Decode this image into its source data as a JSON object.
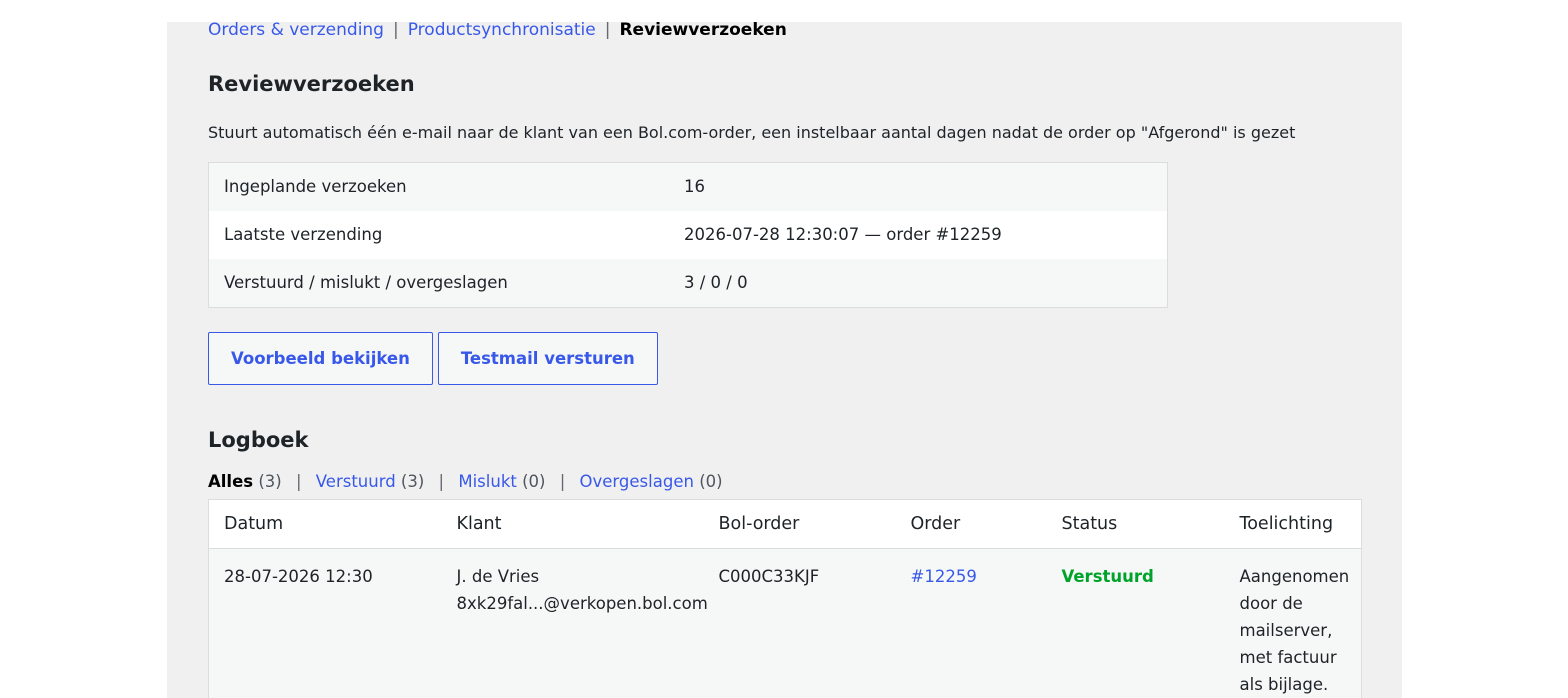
{
  "subnav": {
    "items": [
      "Orders & verzending",
      "Productsynchronisatie"
    ],
    "current": "Reviewverzoeken",
    "separator": "|"
  },
  "page": {
    "title": "Reviewverzoeken",
    "description": "Stuurt automatisch één e-mail naar de klant van een Bol.com-order, een instelbaar aantal dagen nadat de order op \"Afgerond\" is gezet"
  },
  "stats": [
    {
      "label": "Ingeplande verzoeken",
      "value": "16"
    },
    {
      "label": "Laatste verzending",
      "value": "2026-07-28 12:30:07 — order #12259"
    },
    {
      "label": "Verstuurd / mislukt / overgeslagen",
      "value": "3 / 0 / 0"
    }
  ],
  "buttons": {
    "preview": "Voorbeeld bekijken",
    "testmail": "Testmail versturen"
  },
  "log": {
    "title": "Logboek",
    "filters": [
      {
        "label": "Alles",
        "count": "(3)"
      },
      {
        "label": "Verstuurd",
        "count": "(3)"
      },
      {
        "label": "Mislukt",
        "count": "(0)"
      },
      {
        "label": "Overgeslagen",
        "count": "(0)"
      }
    ],
    "columns": [
      "Datum",
      "Klant",
      "Bol-order",
      "Order",
      "Status",
      "Toelichting"
    ],
    "rows": [
      {
        "date": "28-07-2026 12:30",
        "customer_name": "J. de Vries",
        "customer_email": "8xk29fal...@verkopen.bol.com",
        "bol_order": "C000C33KJF",
        "order": "#12259",
        "status": "Verstuurd",
        "note_lines": [
          "Aangenomen",
          "door de",
          "mailserver,",
          "met factuur",
          "als bijlage."
        ]
      }
    ]
  },
  "colors": {
    "link": "#3858e9",
    "success": "#00a32a",
    "panel_bg": "#f0f0f1"
  }
}
